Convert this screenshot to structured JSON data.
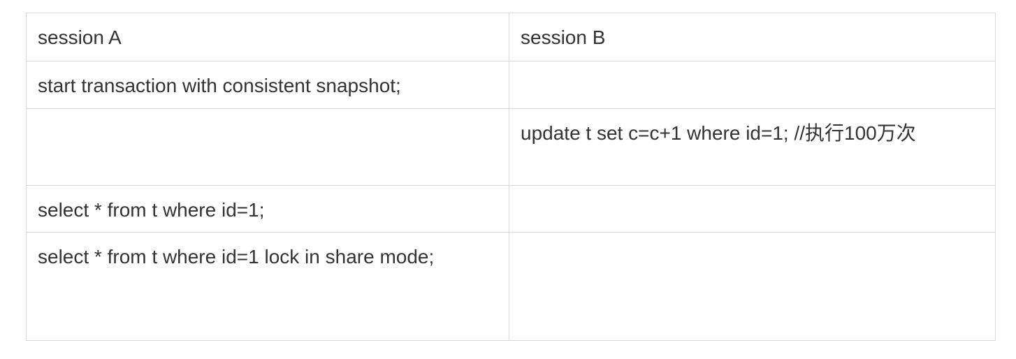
{
  "table": {
    "header": {
      "col_a": "session A",
      "col_b": "session B"
    },
    "rows": [
      {
        "a": "start transaction with consistent snapshot;",
        "b": ""
      },
      {
        "a": "",
        "b": "update t set c=c+1 where id=1; //执行100万次"
      },
      {
        "a": "select * from t where id=1;",
        "b": ""
      },
      {
        "a": "select * from t where id=1 lock in share mode;",
        "b": ""
      }
    ]
  }
}
